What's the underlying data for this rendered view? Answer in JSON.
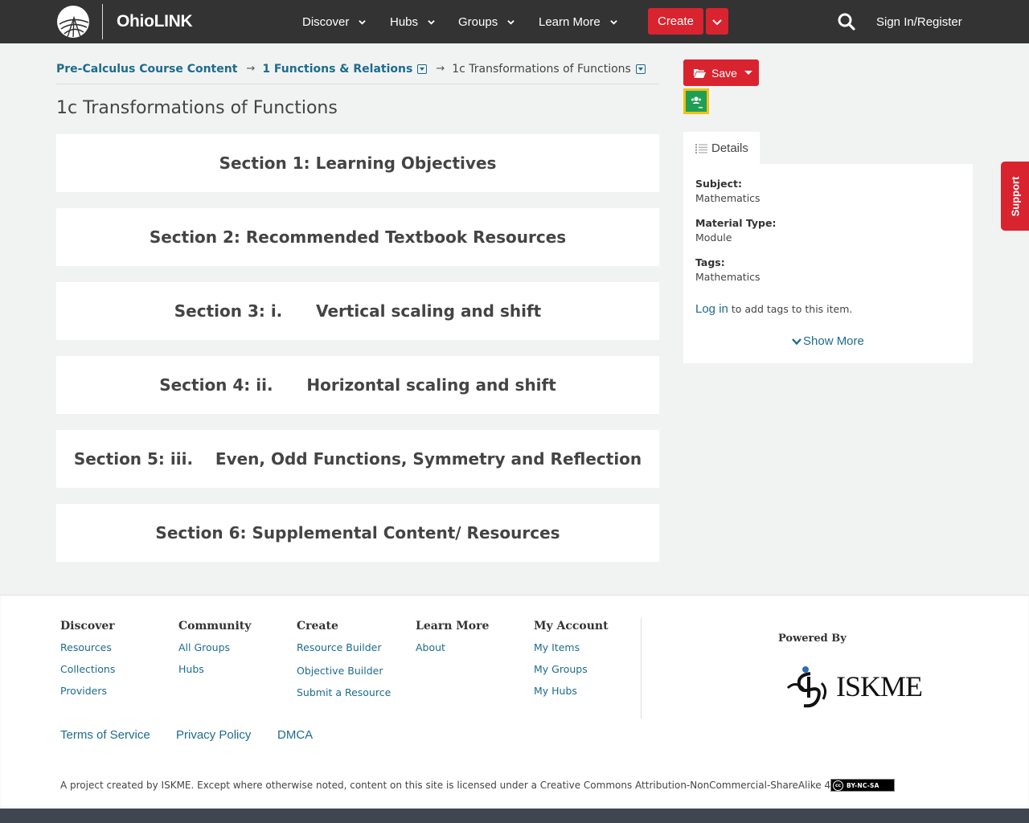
{
  "header": {
    "logo_text": "OhioLINK",
    "nav": [
      {
        "label": "Discover"
      },
      {
        "label": "Hubs"
      },
      {
        "label": "Groups"
      },
      {
        "label": "Learn More"
      }
    ],
    "create_label": "Create",
    "signin_label": "Sign In/Register"
  },
  "breadcrumb": {
    "items": [
      "Pre-Calculus Course Content",
      "1 Functions & Relations",
      "1c Transformations of Functions"
    ],
    "separator": "→"
  },
  "page_title": "1c Transformations of Functions",
  "sections": [
    "Section 1: Learning Objectives",
    "Section 2: Recommended Textbook Resources",
    "Section 3: i.      Vertical scaling and shift",
    "Section 4: ii.      Horizontal scaling and shift",
    "Section 5: iii.    Even, Odd Functions, Symmetry and Reflection",
    "Section 6: Supplemental Content/ Resources"
  ],
  "sidebar": {
    "save_label": "Save",
    "details_tab": "Details",
    "subject_label": "Subject:",
    "subject_value": "Mathematics",
    "material_label": "Material Type:",
    "material_value": "Module",
    "tags_label": "Tags:",
    "tags_value": "Mathematics",
    "login_link": "Log in",
    "login_suffix": " to add tags to this item.",
    "show_more": "Show More"
  },
  "support_label": "Support",
  "footer": {
    "columns": [
      {
        "heading": "Discover",
        "links": [
          "Resources",
          "Collections",
          "Providers"
        ]
      },
      {
        "heading": "Community",
        "links": [
          "All Groups",
          "Hubs"
        ]
      },
      {
        "heading": "Create",
        "links": [
          "Resource Builder",
          "Objective Builder",
          "Submit a Resource"
        ]
      },
      {
        "heading": "Learn More",
        "links": [
          "About"
        ]
      },
      {
        "heading": "My Account",
        "links": [
          "My Items",
          "My Groups",
          "My Hubs"
        ]
      }
    ],
    "powered_by": "Powered By",
    "iskme_text": "ISKME",
    "legal_links": [
      "Terms of Service",
      "Privacy Policy",
      "DMCA"
    ],
    "license_text": "A project created by ISKME. Except where otherwise noted, content on this site is licensed under a Creative Commons Attribution-NonCommercial-ShareAlike 4.0 License.",
    "cc_badge_text": "BY-NC-SA",
    "cc_symbol": "cc"
  },
  "colors": {
    "header_bg": "#333333",
    "accent_red": "#d9232f",
    "link_blue": "#1d6b8e",
    "page_bg": "#f1f3f2"
  },
  "icons": [
    "ohiolink-globe-icon",
    "chevron-down-icon",
    "search-icon",
    "folder-open-icon",
    "google-classroom-icon",
    "list-icon",
    "cc-icon"
  ]
}
